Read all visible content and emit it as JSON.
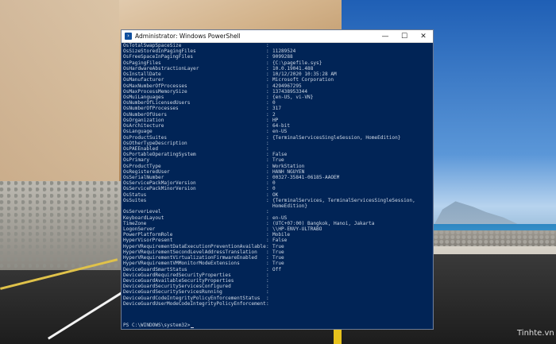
{
  "window": {
    "title": "Administrator: Windows PowerShell",
    "icon": "powershell-icon",
    "controls": {
      "minimize": "—",
      "maximize": "☐",
      "close": "✕"
    }
  },
  "console": {
    "separator": ":",
    "rows": [
      {
        "k": "OsTotalSwapSpaceSize",
        "v": ""
      },
      {
        "k": "OsSizeStoredInPagingFiles",
        "v": "11289524"
      },
      {
        "k": "OsFreeSpaceInPagingFiles",
        "v": "9099288"
      },
      {
        "k": "OsPagingFiles",
        "v": "{C:\\pagefile.sys}"
      },
      {
        "k": "OsHardwareAbstractionLayer",
        "v": "10.0.19041.488"
      },
      {
        "k": "OsInstallDate",
        "v": "10/12/2020 10:35:28 AM"
      },
      {
        "k": "OsManufacturer",
        "v": "Microsoft Corporation"
      },
      {
        "k": "OsMaxNumberOfProcesses",
        "v": "4294967295"
      },
      {
        "k": "OsMaxProcessMemorySize",
        "v": "137438953344"
      },
      {
        "k": "OsMuiLanguages",
        "v": "{en-US, vi-VN}"
      },
      {
        "k": "OsNumberOfLicensedUsers",
        "v": "0"
      },
      {
        "k": "OsNumberOfProcesses",
        "v": "317"
      },
      {
        "k": "OsNumberOfUsers",
        "v": "2"
      },
      {
        "k": "OsOrganization",
        "v": "HP"
      },
      {
        "k": "OsArchitecture",
        "v": "64-bit"
      },
      {
        "k": "OsLanguage",
        "v": "en-US"
      },
      {
        "k": "OsProductSuites",
        "v": "{TerminalServicesSingleSession, HomeEdition}"
      },
      {
        "k": "OsOtherTypeDescription",
        "v": ""
      },
      {
        "k": "OsPAEEnabled",
        "v": ""
      },
      {
        "k": "OsPortableOperatingSystem",
        "v": "False"
      },
      {
        "k": "OsPrimary",
        "v": "True"
      },
      {
        "k": "OsProductType",
        "v": "WorkStation"
      },
      {
        "k": "OsRegisteredUser",
        "v": "HANH NGUYEN"
      },
      {
        "k": "OsSerialNumber",
        "v": "00327-35841-06185-AAOEM"
      },
      {
        "k": "OsServicePackMajorVersion",
        "v": "0"
      },
      {
        "k": "OsServicePackMinorVersion",
        "v": "0"
      },
      {
        "k": "OsStatus",
        "v": "OK"
      },
      {
        "k": "OsSuites",
        "v": "{TerminalServices, TerminalServicesSingleSession,"
      },
      {
        "k": "",
        "v": "HomeEdition}",
        "cont": true
      },
      {
        "k": "OsServerLevel",
        "v": ""
      },
      {
        "k": "KeyboardLayout",
        "v": "en-US"
      },
      {
        "k": "TimeZone",
        "v": "(UTC+07:00) Bangkok, Hanoi, Jakarta"
      },
      {
        "k": "LogonServer",
        "v": "\\\\HP-ENVY-ULTRABO"
      },
      {
        "k": "PowerPlatformRole",
        "v": "Mobile"
      },
      {
        "k": "HyperVisorPresent",
        "v": "False"
      },
      {
        "k": "HyperVRequirementDataExecutionPreventionAvailable",
        "v": "True"
      },
      {
        "k": "HyperVRequirementSecondLevelAddressTranslation",
        "v": "True"
      },
      {
        "k": "HyperVRequirementVirtualizationFirmwareEnabled",
        "v": "True"
      },
      {
        "k": "HyperVRequirementVMMonitorModeExtensions",
        "v": "True"
      },
      {
        "k": "DeviceGuardSmartStatus",
        "v": "Off"
      },
      {
        "k": "DeviceGuardRequiredSecurityProperties",
        "v": ""
      },
      {
        "k": "DeviceGuardAvailableSecurityProperties",
        "v": ""
      },
      {
        "k": "DeviceGuardSecurityServicesConfigured",
        "v": ""
      },
      {
        "k": "DeviceGuardSecurityServicesRunning",
        "v": ""
      },
      {
        "k": "DeviceGuardCodeIntegrityPolicyEnforcementStatus",
        "v": ""
      },
      {
        "k": "DeviceGuardUserModeCodeIntegrityPolicyEnforcementStatus",
        "v": ""
      }
    ],
    "prompt": "PS C:\\WINDOWS\\system32>"
  },
  "desktop": {
    "watermark": "Tinhte.vn"
  }
}
